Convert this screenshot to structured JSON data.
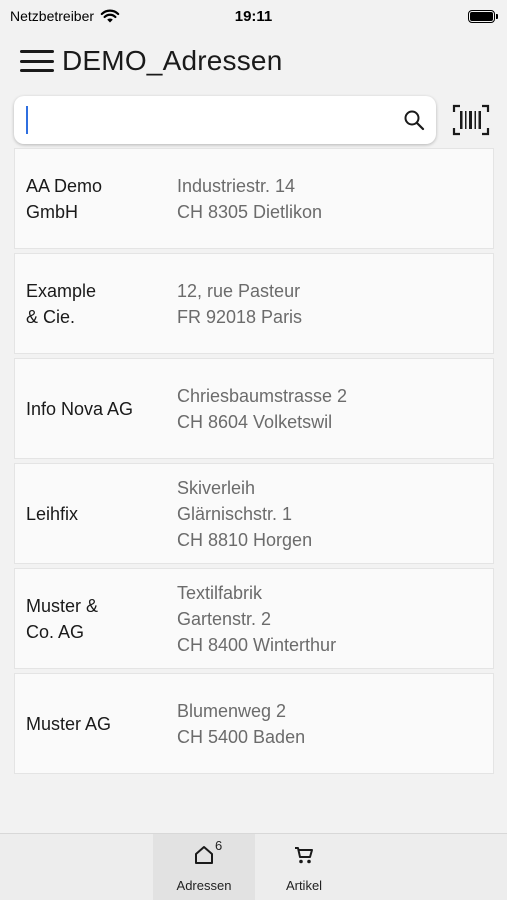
{
  "status": {
    "carrier": "Netzbetreiber",
    "time": "19:11"
  },
  "header": {
    "title": "DEMO_Adressen"
  },
  "search": {
    "value": "",
    "placeholder": ""
  },
  "addresses": [
    {
      "name_lines": [
        "AA Demo",
        "GmbH"
      ],
      "address_lines": [
        "Industriestr. 14",
        "CH 8305 Dietlikon"
      ]
    },
    {
      "name_lines": [
        "Example",
        "& Cie."
      ],
      "address_lines": [
        "12, rue Pasteur",
        "FR 92018 Paris"
      ]
    },
    {
      "name_lines": [
        "Info Nova AG"
      ],
      "address_lines": [
        "Chriesbaumstrasse 2",
        "CH 8604 Volketswil"
      ]
    },
    {
      "name_lines": [
        "Leihfix"
      ],
      "address_lines": [
        "Skiverleih",
        "Glärnischstr. 1",
        "CH 8810 Horgen"
      ]
    },
    {
      "name_lines": [
        "Muster &",
        "Co. AG"
      ],
      "address_lines": [
        "Textilfabrik",
        "Gartenstr. 2",
        "CH 8400 Winterthur"
      ]
    },
    {
      "name_lines": [
        "Muster AG"
      ],
      "address_lines": [
        "Blumenweg 2",
        "CH 5400 Baden"
      ]
    }
  ],
  "tabbar": {
    "tabs": [
      {
        "label": "Adressen",
        "icon": "home-icon",
        "badge": "6",
        "active": true
      },
      {
        "label": "Artikel",
        "icon": "cart-icon",
        "badge": "",
        "active": false
      }
    ]
  },
  "colors": {
    "background": "#f2f2f2",
    "caret": "#2f6fe0",
    "secondary_text": "#6b6b6b"
  }
}
